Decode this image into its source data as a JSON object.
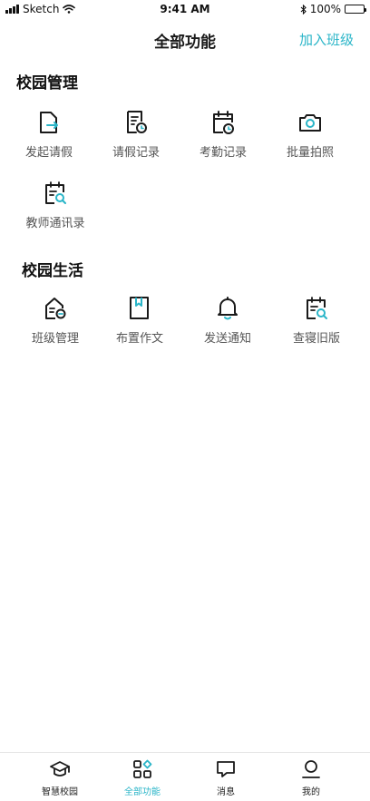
{
  "status_bar": {
    "carrier": "Sketch",
    "time": "9:41 AM",
    "battery": "100%"
  },
  "nav": {
    "title": "全部功能",
    "action": "加入班级"
  },
  "sections": [
    {
      "title": "校园管理",
      "items": [
        {
          "label": "发起请假",
          "icon": "document-arrow-icon"
        },
        {
          "label": "请假记录",
          "icon": "record-clock-icon"
        },
        {
          "label": "考勤记录",
          "icon": "calendar-clock-icon"
        },
        {
          "label": "批量拍照",
          "icon": "camera-icon"
        },
        {
          "label": "教师通讯录",
          "icon": "calendar-search-icon"
        }
      ]
    },
    {
      "title": "校园生活",
      "items": [
        {
          "label": "班级管理",
          "icon": "class-house-icon"
        },
        {
          "label": "布置作文",
          "icon": "book-icon"
        },
        {
          "label": "发送通知",
          "icon": "bell-icon"
        },
        {
          "label": "查寝旧版",
          "icon": "calendar-search-icon"
        }
      ]
    }
  ],
  "tabs": [
    {
      "label": "智慧校园",
      "icon": "graduation-cap-icon",
      "active": false
    },
    {
      "label": "全部功能",
      "icon": "grid-icon",
      "active": true
    },
    {
      "label": "消息",
      "icon": "message-icon",
      "active": false
    },
    {
      "label": "我的",
      "icon": "user-icon",
      "active": false
    }
  ],
  "colors": {
    "accent": "#2ab5c8",
    "icon": "#1a1a1a",
    "label": "#555555"
  }
}
